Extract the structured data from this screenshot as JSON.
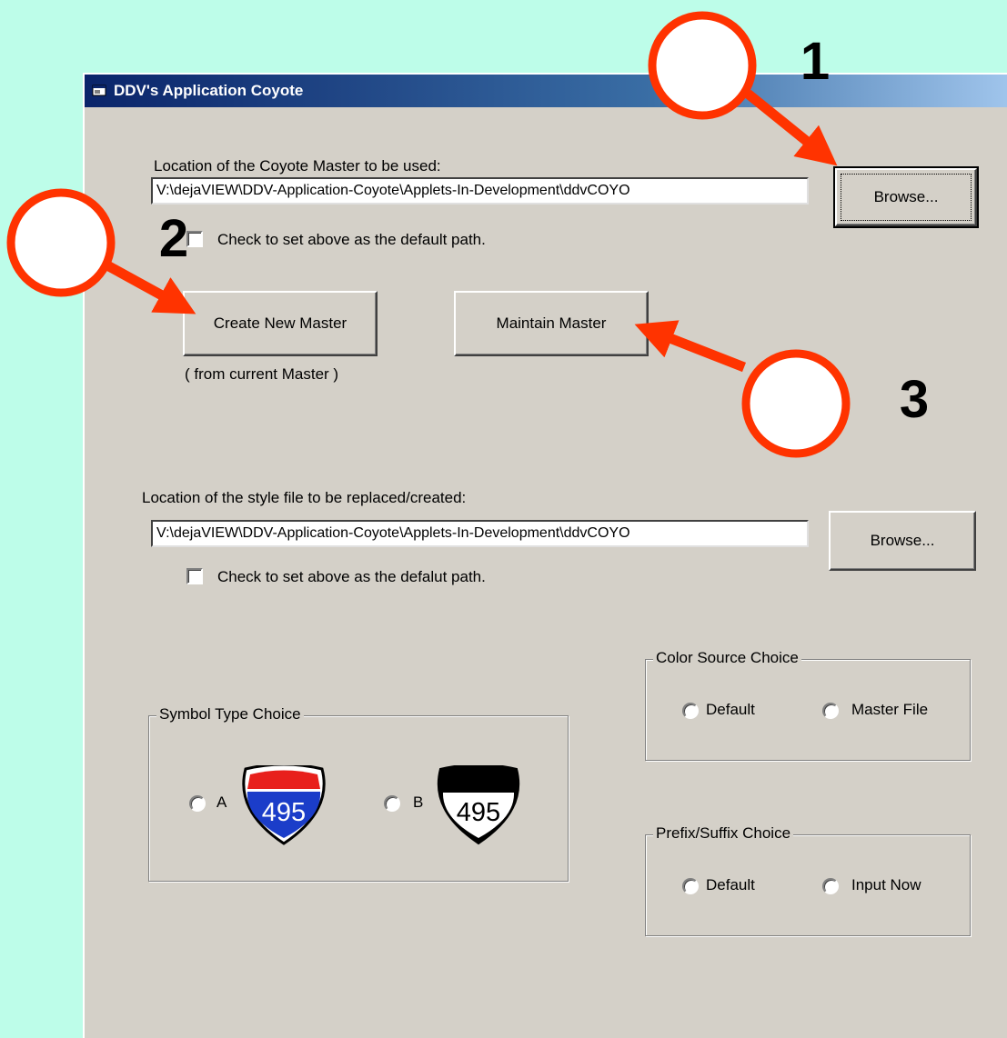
{
  "window": {
    "title": "DDV's Application Coyote"
  },
  "master": {
    "label": "Location of the Coyote Master to be used:",
    "path": "V:\\dejaVIEW\\DDV-Application-Coyote\\Applets-In-Development\\ddvCOYO",
    "browse_label": "Browse...",
    "default_checkbox_label": "Check to set above as the default path."
  },
  "actions": {
    "create_label": "Create New Master",
    "create_note": "( from current Master )",
    "maintain_label": "Maintain Master"
  },
  "style_file": {
    "label": "Location of the style file to be replaced/created:",
    "path": "V:\\dejaVIEW\\DDV-Application-Coyote\\Applets-In-Development\\ddvCOYO",
    "browse_label": "Browse...",
    "default_checkbox_label": "Check to set above as the defalut path."
  },
  "color_source": {
    "title": "Color Source Choice",
    "options": [
      "Default",
      "Master File"
    ]
  },
  "symbol_type": {
    "title": "Symbol Type Choice",
    "option_a": "A",
    "option_b": "B",
    "shield_number": "495"
  },
  "prefix_suffix": {
    "title": "Prefix/Suffix Choice",
    "options": [
      "Default",
      "Input Now"
    ]
  },
  "callouts": [
    "1",
    "2",
    "3"
  ],
  "colors": {
    "background": "#bdfde9",
    "callout_fill": "#ffffff",
    "callout_ring": "#ff3300",
    "arrow": "#ff3300",
    "shield_red": "#e8201c",
    "shield_blue": "#1b3dc9"
  }
}
